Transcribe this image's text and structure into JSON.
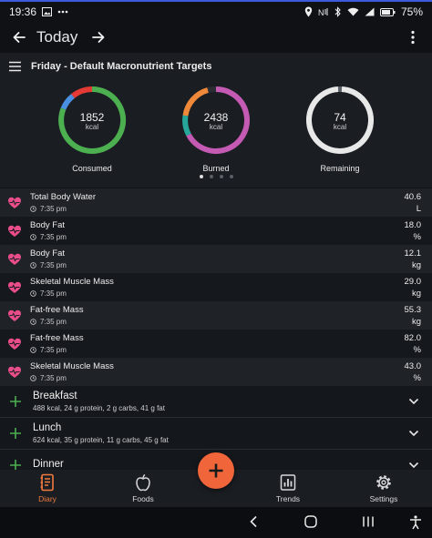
{
  "status": {
    "time": "19:36",
    "battery": "75%"
  },
  "appbar": {
    "title": "Today"
  },
  "subheader": {
    "title": "Friday - Default Macronutrient Targets"
  },
  "rings": [
    {
      "value": "1852",
      "unit": "kcal",
      "label": "Consumed"
    },
    {
      "value": "2438",
      "unit": "kcal",
      "label": "Burned"
    },
    {
      "value": "74",
      "unit": "kcal",
      "label": "Remaining"
    }
  ],
  "metrics": [
    {
      "name": "Total Body Water",
      "time": "7:35 pm",
      "value": "40.6",
      "unit": "L"
    },
    {
      "name": "Body Fat",
      "time": "7:35 pm",
      "value": "18.0",
      "unit": "%"
    },
    {
      "name": "Body Fat",
      "time": "7:35 pm",
      "value": "12.1",
      "unit": "kg"
    },
    {
      "name": "Skeletal Muscle Mass",
      "time": "7:35 pm",
      "value": "29.0",
      "unit": "kg"
    },
    {
      "name": "Fat-free Mass",
      "time": "7:35 pm",
      "value": "55.3",
      "unit": "kg"
    },
    {
      "name": "Fat-free Mass",
      "time": "7:35 pm",
      "value": "82.0",
      "unit": "%"
    },
    {
      "name": "Skeletal Muscle Mass",
      "time": "7:35 pm",
      "value": "43.0",
      "unit": "%"
    }
  ],
  "meals": [
    {
      "name": "Breakfast",
      "summary": "488 kcal, 24 g protein, 2 g carbs, 41 g fat"
    },
    {
      "name": "Lunch",
      "summary": "624 kcal, 35 g protein, 11 g carbs, 45 g fat"
    },
    {
      "name": "Dinner",
      "summary": ""
    }
  ],
  "nav": {
    "diary": "Diary",
    "foods": "Foods",
    "trends": "Trends",
    "settings": "Settings"
  },
  "colors": {
    "accent": "#f0663a",
    "heart": "#e94d8a",
    "plus": "#4caf50"
  }
}
